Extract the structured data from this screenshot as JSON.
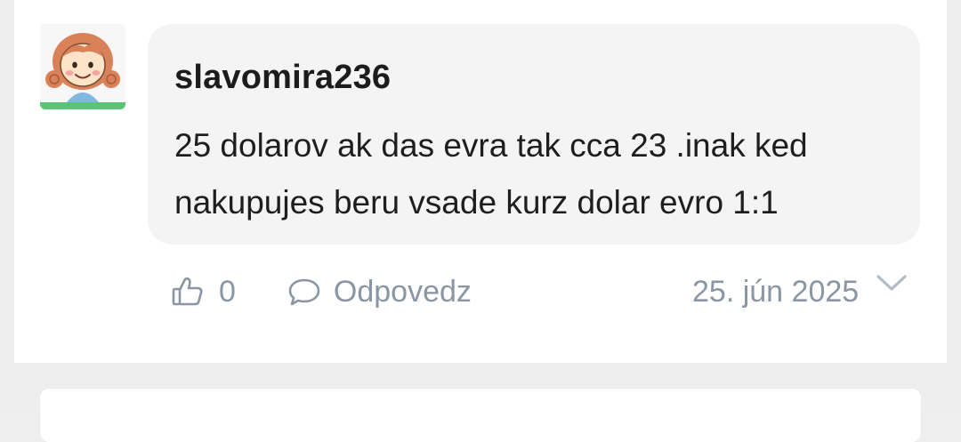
{
  "comment": {
    "author": "slavomira236",
    "text": "25 dolarov ak das evra tak cca 23 .inak ked nakupujes beru vsade kurz dolar evro 1:1",
    "likes": "0",
    "reply_label": "Odpovedz",
    "date": "25. jún 2025"
  },
  "icons": {
    "avatar": "cartoon-girl-avatar",
    "like": "thumbs-up-icon",
    "reply": "speech-bubble-icon",
    "expand": "chevron-down-icon"
  },
  "colors": {
    "accent_green": "#5ac476",
    "muted_text": "#8a96a3",
    "bubble_bg": "#f4f4f4"
  }
}
